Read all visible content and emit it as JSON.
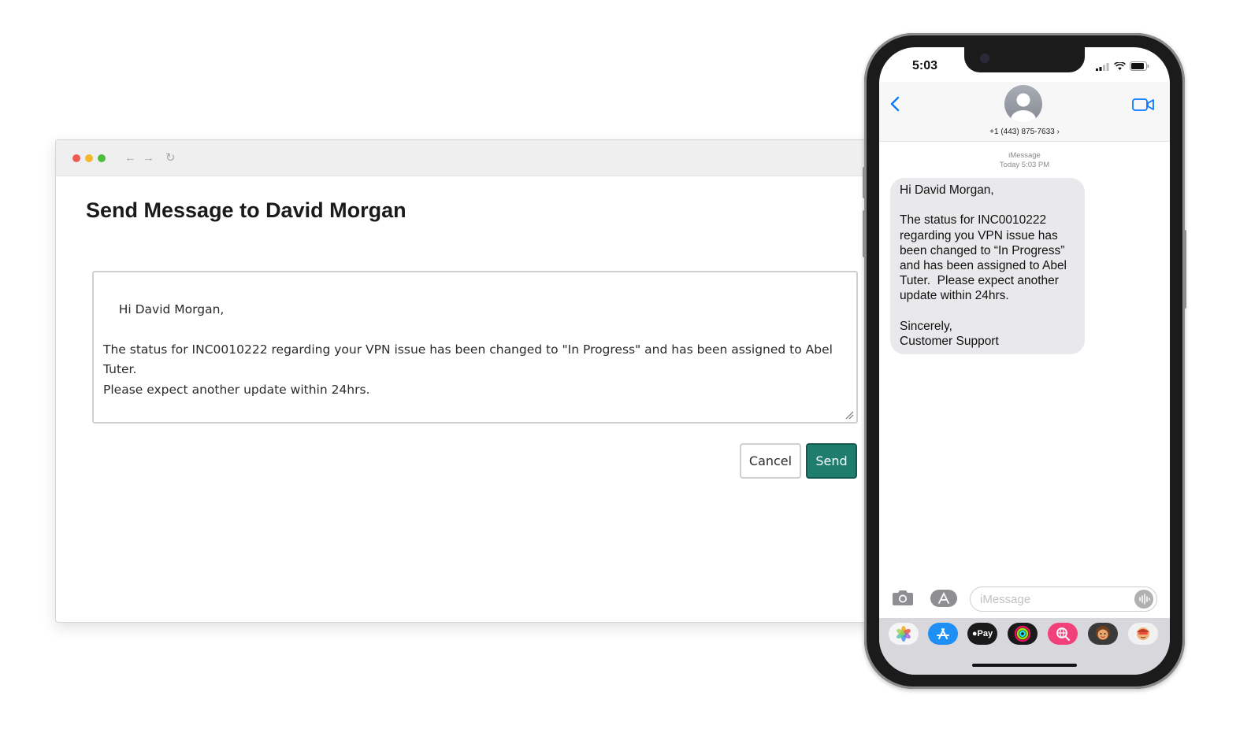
{
  "browser": {
    "page_title": "Send Message to David Morgan",
    "message_body": "Hi David Morgan,\n\nThe status for INC0010222 regarding your VPN issue has been changed to \"In Progress\" and has been assigned to Abel Tuter.\nPlease expect another update within 24hrs.\n\nSincerely,\nCustomer Support",
    "cancel_label": "Cancel",
    "send_label": "Send",
    "send_color": "#1f7d6d",
    "nav_icons": [
      "back-arrow-icon",
      "forward-arrow-icon",
      "reload-icon"
    ]
  },
  "phone": {
    "status_time": "5:03",
    "contact_number": "+1 (443) 875-7633 ›",
    "service_name": "iMessage",
    "service_time": "Today 5:03 PM",
    "bubble_text": "Hi David Morgan,\n\nThe status for INC0010222 regarding you VPN issue has been changed to “In Progress” and has been assigned to Abel Tuter.  Please expect another update within 24hrs.\n\nSincerely,\nCustomer Support",
    "input_placeholder": "iMessage",
    "apple_pay_label": "Pay",
    "accent_color": "#0a7aff",
    "app_tray_icons": [
      "photos-icon",
      "app-store-icon",
      "apple-pay-icon",
      "activity-icon",
      "globe-search-icon",
      "memoji-icon",
      "memoji-2-icon"
    ]
  }
}
